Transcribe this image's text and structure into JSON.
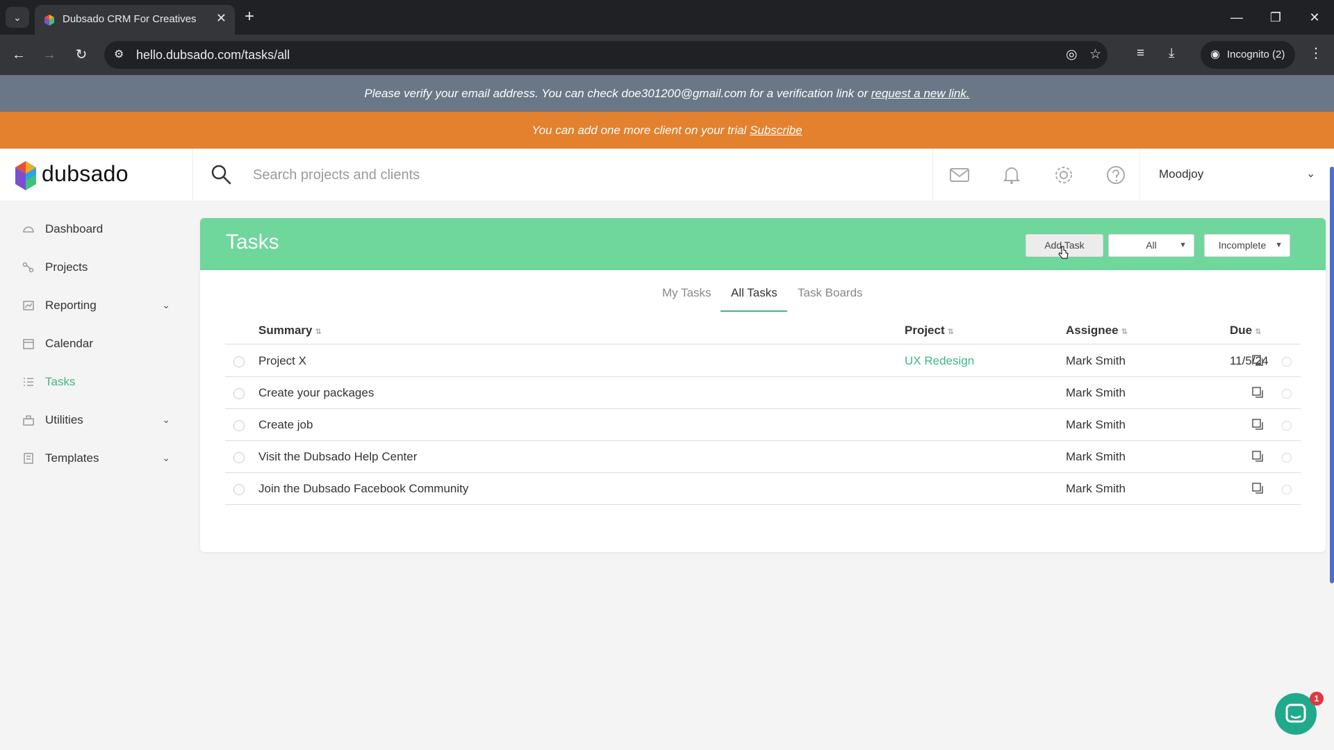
{
  "browser": {
    "tab_title": "Dubsado CRM For Creatives",
    "url": "hello.dubsado.com/tasks/all",
    "incognito_label": "Incognito (2)"
  },
  "banners": {
    "verify_text": "Please verify your email address. You can check doe301200@gmail.com for a verification link or",
    "verify_link": "request a new link.",
    "trial_text": "You can add one more client on your trial",
    "trial_link": "Subscribe"
  },
  "header": {
    "logo_text": "dubsado",
    "search_placeholder": "Search projects and clients",
    "user_name": "Moodjoy"
  },
  "sidebar": {
    "items": [
      {
        "label": "Dashboard",
        "icon": "dashboard-icon",
        "has_chevron": false,
        "active": false
      },
      {
        "label": "Projects",
        "icon": "projects-icon",
        "has_chevron": false,
        "active": false
      },
      {
        "label": "Reporting",
        "icon": "reporting-icon",
        "has_chevron": true,
        "active": false
      },
      {
        "label": "Calendar",
        "icon": "calendar-icon",
        "has_chevron": false,
        "active": false
      },
      {
        "label": "Tasks",
        "icon": "tasks-icon",
        "has_chevron": false,
        "active": true
      },
      {
        "label": "Utilities",
        "icon": "utilities-icon",
        "has_chevron": true,
        "active": false
      },
      {
        "label": "Templates",
        "icon": "templates-icon",
        "has_chevron": true,
        "active": false
      }
    ]
  },
  "tasks": {
    "title": "Tasks",
    "add_button": "Add Task",
    "filter_scope": "All",
    "filter_status": "Incomplete",
    "tabs": [
      {
        "label": "My Tasks",
        "active": false
      },
      {
        "label": "All Tasks",
        "active": true
      },
      {
        "label": "Task Boards",
        "active": false
      }
    ],
    "columns": {
      "summary": "Summary",
      "project": "Project",
      "assignee": "Assignee",
      "due": "Due"
    },
    "rows": [
      {
        "summary": "Project X",
        "project": "UX Redesign",
        "assignee": "Mark Smith",
        "due": "11/5/24"
      },
      {
        "summary": "Create your packages",
        "project": "",
        "assignee": "Mark Smith",
        "due": ""
      },
      {
        "summary": "Create job",
        "project": "",
        "assignee": "Mark Smith",
        "due": ""
      },
      {
        "summary": "Visit the Dubsado Help Center",
        "project": "",
        "assignee": "Mark Smith",
        "due": ""
      },
      {
        "summary": "Join the Dubsado Facebook Community",
        "project": "",
        "assignee": "Mark Smith",
        "due": ""
      }
    ]
  },
  "chat": {
    "badge": "1"
  },
  "colors": {
    "accent_green": "#41b783",
    "header_green": "#6fd69c",
    "verify_banner": "#6a7787",
    "trial_banner": "#e4812e"
  }
}
